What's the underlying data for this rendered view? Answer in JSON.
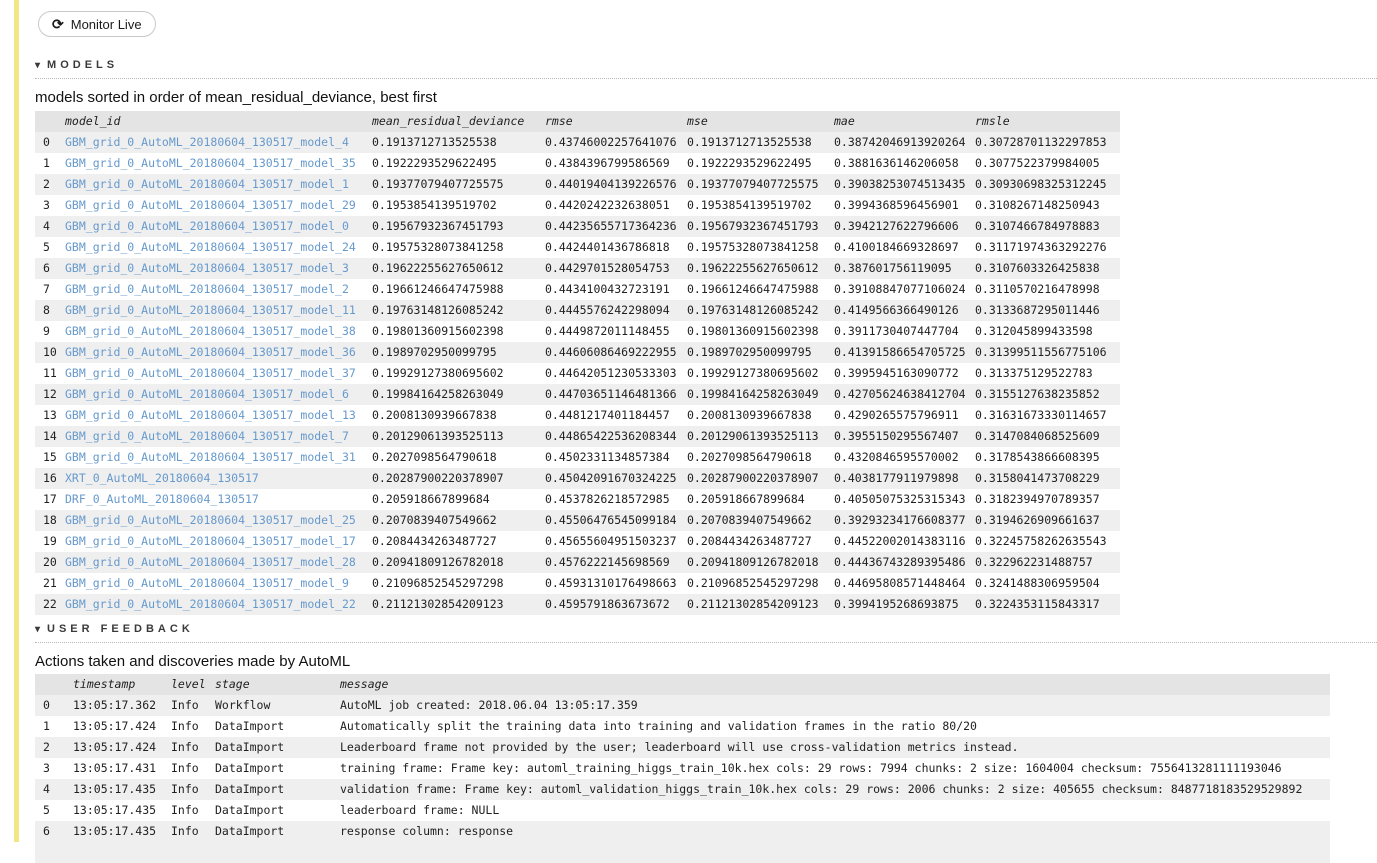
{
  "colors": {
    "link_blue": "#6699cc",
    "band_gray": "#efefef",
    "header_gray": "#e4e4e4",
    "cell_border_yellow": "#f2e784"
  },
  "toolbar": {
    "monitor_live_label": "Monitor Live",
    "refresh_icon": "clockwise-refresh-arrows"
  },
  "models_section": {
    "title": "MODELS",
    "caret_icon": "down-triangle",
    "caption": "models sorted in order of mean_residual_deviance, best first",
    "columns": [
      "model_id",
      "mean_residual_deviance",
      "rmse",
      "mse",
      "mae",
      "rmsle"
    ],
    "rows": [
      {
        "idx": "0",
        "model_id": "GBM_grid_0_AutoML_20180604_130517_model_4",
        "mean_residual_deviance": "0.1913712713525538",
        "rmse": "0.43746002257641076",
        "mse": "0.1913712713525538",
        "mae": "0.38742046913920264",
        "rmsle": "0.30728701132297853"
      },
      {
        "idx": "1",
        "model_id": "GBM_grid_0_AutoML_20180604_130517_model_35",
        "mean_residual_deviance": "0.1922293529622495",
        "rmse": "0.4384396799586569",
        "mse": "0.1922293529622495",
        "mae": "0.3881636146206058",
        "rmsle": "0.3077522379984005"
      },
      {
        "idx": "2",
        "model_id": "GBM_grid_0_AutoML_20180604_130517_model_1",
        "mean_residual_deviance": "0.19377079407725575",
        "rmse": "0.44019404139226576",
        "mse": "0.19377079407725575",
        "mae": "0.39038253074513435",
        "rmsle": "0.30930698325312245"
      },
      {
        "idx": "3",
        "model_id": "GBM_grid_0_AutoML_20180604_130517_model_29",
        "mean_residual_deviance": "0.1953854139519702",
        "rmse": "0.4420242232638051",
        "mse": "0.1953854139519702",
        "mae": "0.3994368596456901",
        "rmsle": "0.3108267148250943"
      },
      {
        "idx": "4",
        "model_id": "GBM_grid_0_AutoML_20180604_130517_model_0",
        "mean_residual_deviance": "0.19567932367451793",
        "rmse": "0.44235655717364236",
        "mse": "0.19567932367451793",
        "mae": "0.3942127622796606",
        "rmsle": "0.3107466784978883"
      },
      {
        "idx": "5",
        "model_id": "GBM_grid_0_AutoML_20180604_130517_model_24",
        "mean_residual_deviance": "0.19575328073841258",
        "rmse": "0.4424401436786818",
        "mse": "0.19575328073841258",
        "mae": "0.4100184669328697",
        "rmsle": "0.31171974363292276"
      },
      {
        "idx": "6",
        "model_id": "GBM_grid_0_AutoML_20180604_130517_model_3",
        "mean_residual_deviance": "0.19622255627650612",
        "rmse": "0.4429701528054753",
        "mse": "0.19622255627650612",
        "mae": "0.387601756119095",
        "rmsle": "0.3107603326425838"
      },
      {
        "idx": "7",
        "model_id": "GBM_grid_0_AutoML_20180604_130517_model_2",
        "mean_residual_deviance": "0.19661246647475988",
        "rmse": "0.4434100432723191",
        "mse": "0.19661246647475988",
        "mae": "0.39108847077106024",
        "rmsle": "0.3110570216478998"
      },
      {
        "idx": "8",
        "model_id": "GBM_grid_0_AutoML_20180604_130517_model_11",
        "mean_residual_deviance": "0.19763148126085242",
        "rmse": "0.4445576242298094",
        "mse": "0.19763148126085242",
        "mae": "0.4149566366490126",
        "rmsle": "0.3133687295011446"
      },
      {
        "idx": "9",
        "model_id": "GBM_grid_0_AutoML_20180604_130517_model_38",
        "mean_residual_deviance": "0.19801360915602398",
        "rmse": "0.4449872011148455",
        "mse": "0.19801360915602398",
        "mae": "0.3911730407447704",
        "rmsle": "0.312045899433598"
      },
      {
        "idx": "10",
        "model_id": "GBM_grid_0_AutoML_20180604_130517_model_36",
        "mean_residual_deviance": "0.1989702950099795",
        "rmse": "0.44606086469222955",
        "mse": "0.1989702950099795",
        "mae": "0.41391586654705725",
        "rmsle": "0.31399511556775106"
      },
      {
        "idx": "11",
        "model_id": "GBM_grid_0_AutoML_20180604_130517_model_37",
        "mean_residual_deviance": "0.19929127380695602",
        "rmse": "0.44642051230533303",
        "mse": "0.19929127380695602",
        "mae": "0.3995945163090772",
        "rmsle": "0.313375129522783"
      },
      {
        "idx": "12",
        "model_id": "GBM_grid_0_AutoML_20180604_130517_model_6",
        "mean_residual_deviance": "0.19984164258263049",
        "rmse": "0.44703651146481366",
        "mse": "0.19984164258263049",
        "mae": "0.42705624638412704",
        "rmsle": "0.3155127638235852"
      },
      {
        "idx": "13",
        "model_id": "GBM_grid_0_AutoML_20180604_130517_model_13",
        "mean_residual_deviance": "0.2008130939667838",
        "rmse": "0.4481217401184457",
        "mse": "0.2008130939667838",
        "mae": "0.4290265575796911",
        "rmsle": "0.31631673330114657"
      },
      {
        "idx": "14",
        "model_id": "GBM_grid_0_AutoML_20180604_130517_model_7",
        "mean_residual_deviance": "0.20129061393525113",
        "rmse": "0.44865422536208344",
        "mse": "0.20129061393525113",
        "mae": "0.3955150295567407",
        "rmsle": "0.3147084068525609"
      },
      {
        "idx": "15",
        "model_id": "GBM_grid_0_AutoML_20180604_130517_model_31",
        "mean_residual_deviance": "0.2027098564790618",
        "rmse": "0.4502331134857384",
        "mse": "0.2027098564790618",
        "mae": "0.4320846595570002",
        "rmsle": "0.3178543866608395"
      },
      {
        "idx": "16",
        "model_id": "XRT_0_AutoML_20180604_130517",
        "mean_residual_deviance": "0.20287900220378907",
        "rmse": "0.45042091670324225",
        "mse": "0.20287900220378907",
        "mae": "0.4038177911979898",
        "rmsle": "0.3158041473708229"
      },
      {
        "idx": "17",
        "model_id": "DRF_0_AutoML_20180604_130517",
        "mean_residual_deviance": "0.205918667899684",
        "rmse": "0.4537826218572985",
        "mse": "0.205918667899684",
        "mae": "0.40505075325315343",
        "rmsle": "0.3182394970789357"
      },
      {
        "idx": "18",
        "model_id": "GBM_grid_0_AutoML_20180604_130517_model_25",
        "mean_residual_deviance": "0.2070839407549662",
        "rmse": "0.45506476545099184",
        "mse": "0.2070839407549662",
        "mae": "0.39293234176608377",
        "rmsle": "0.3194626909661637"
      },
      {
        "idx": "19",
        "model_id": "GBM_grid_0_AutoML_20180604_130517_model_17",
        "mean_residual_deviance": "0.2084434263487727",
        "rmse": "0.45655604951503237",
        "mse": "0.2084434263487727",
        "mae": "0.44522002014383116",
        "rmsle": "0.32245758262635543"
      },
      {
        "idx": "20",
        "model_id": "GBM_grid_0_AutoML_20180604_130517_model_28",
        "mean_residual_deviance": "0.20941809126782018",
        "rmse": "0.4576222145698569",
        "mse": "0.20941809126782018",
        "mae": "0.44436743289395486",
        "rmsle": "0.322962231488757"
      },
      {
        "idx": "21",
        "model_id": "GBM_grid_0_AutoML_20180604_130517_model_9",
        "mean_residual_deviance": "0.21096852545297298",
        "rmse": "0.45931310176498663",
        "mse": "0.21096852545297298",
        "mae": "0.44695808571448464",
        "rmsle": "0.3241488306959504"
      },
      {
        "idx": "22",
        "model_id": "GBM_grid_0_AutoML_20180604_130517_model_22",
        "mean_residual_deviance": "0.21121302854209123",
        "rmse": "0.4595791863673672",
        "mse": "0.21121302854209123",
        "mae": "0.3994195268693875",
        "rmsle": "0.3224353115843317"
      }
    ]
  },
  "feedback_section": {
    "title": "USER FEEDBACK",
    "caret_icon": "down-triangle",
    "caption": "Actions taken and discoveries made by AutoML",
    "columns": [
      "timestamp",
      "level",
      "stage",
      "message"
    ],
    "rows": [
      {
        "idx": "0",
        "timestamp": "13:05:17.362",
        "level": "Info",
        "stage": "Workflow",
        "message": "AutoML job created: 2018.06.04 13:05:17.359"
      },
      {
        "idx": "1",
        "timestamp": "13:05:17.424",
        "level": "Info",
        "stage": "DataImport",
        "message": "Automatically split the training data into training and validation frames in the ratio 80/20"
      },
      {
        "idx": "2",
        "timestamp": "13:05:17.424",
        "level": "Info",
        "stage": "DataImport",
        "message": "Leaderboard frame not provided by the user; leaderboard will use cross-validation metrics instead."
      },
      {
        "idx": "3",
        "timestamp": "13:05:17.431",
        "level": "Info",
        "stage": "DataImport",
        "message": "training frame: Frame key: automl_training_higgs_train_10k.hex cols: 29 rows: 7994 chunks: 2 size: 1604004 checksum: 7556413281111193046"
      },
      {
        "idx": "4",
        "timestamp": "13:05:17.435",
        "level": "Info",
        "stage": "DataImport",
        "message": "validation frame: Frame key: automl_validation_higgs_train_10k.hex cols: 29 rows: 2006 chunks: 2 size: 405655 checksum: 8487718183529529892"
      },
      {
        "idx": "5",
        "timestamp": "13:05:17.435",
        "level": "Info",
        "stage": "DataImport",
        "message": "leaderboard frame: NULL"
      },
      {
        "idx": "6",
        "timestamp": "13:05:17.435",
        "level": "Info",
        "stage": "DataImport",
        "message": "response column: response"
      }
    ]
  }
}
